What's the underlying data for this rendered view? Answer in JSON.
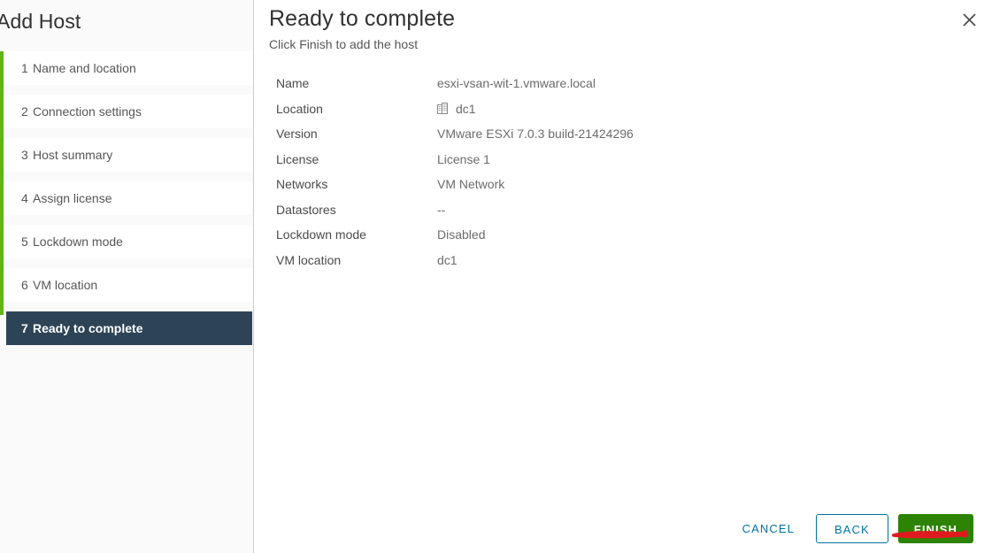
{
  "sidebar": {
    "title": "Add Host",
    "accent_color": "#60b515",
    "active_bg": "#2d4456",
    "steps": [
      {
        "num": "1",
        "label": "Name and location",
        "active": false
      },
      {
        "num": "2",
        "label": "Connection settings",
        "active": false
      },
      {
        "num": "3",
        "label": "Host summary",
        "active": false
      },
      {
        "num": "4",
        "label": "Assign license",
        "active": false
      },
      {
        "num": "5",
        "label": "Lockdown mode",
        "active": false
      },
      {
        "num": "6",
        "label": "VM location",
        "active": false
      },
      {
        "num": "7",
        "label": "Ready to complete",
        "active": true
      }
    ]
  },
  "header": {
    "title": "Ready to complete",
    "subtitle": "Click Finish to add the host",
    "close_icon": "close-icon"
  },
  "summary": {
    "rows": [
      {
        "label": "Name",
        "value": "esxi-vsan-wit-1.vmware.local",
        "icon": ""
      },
      {
        "label": "Location",
        "value": "dc1",
        "icon": "datacenter-icon"
      },
      {
        "label": "Version",
        "value": "VMware ESXi 7.0.3 build-21424296",
        "icon": ""
      },
      {
        "label": "License",
        "value": "License 1",
        "icon": ""
      },
      {
        "label": "Networks",
        "value": "VM Network",
        "icon": ""
      },
      {
        "label": "Datastores",
        "value": "--",
        "icon": ""
      },
      {
        "label": "Lockdown mode",
        "value": "Disabled",
        "icon": ""
      },
      {
        "label": "VM location",
        "value": "dc1",
        "icon": ""
      }
    ]
  },
  "footer": {
    "cancel_label": "CANCEL",
    "back_label": "BACK",
    "finish_label": "FINISH",
    "link_color": "#0072a3",
    "finish_color": "#2d8304",
    "annotation_color": "#e01b20"
  }
}
